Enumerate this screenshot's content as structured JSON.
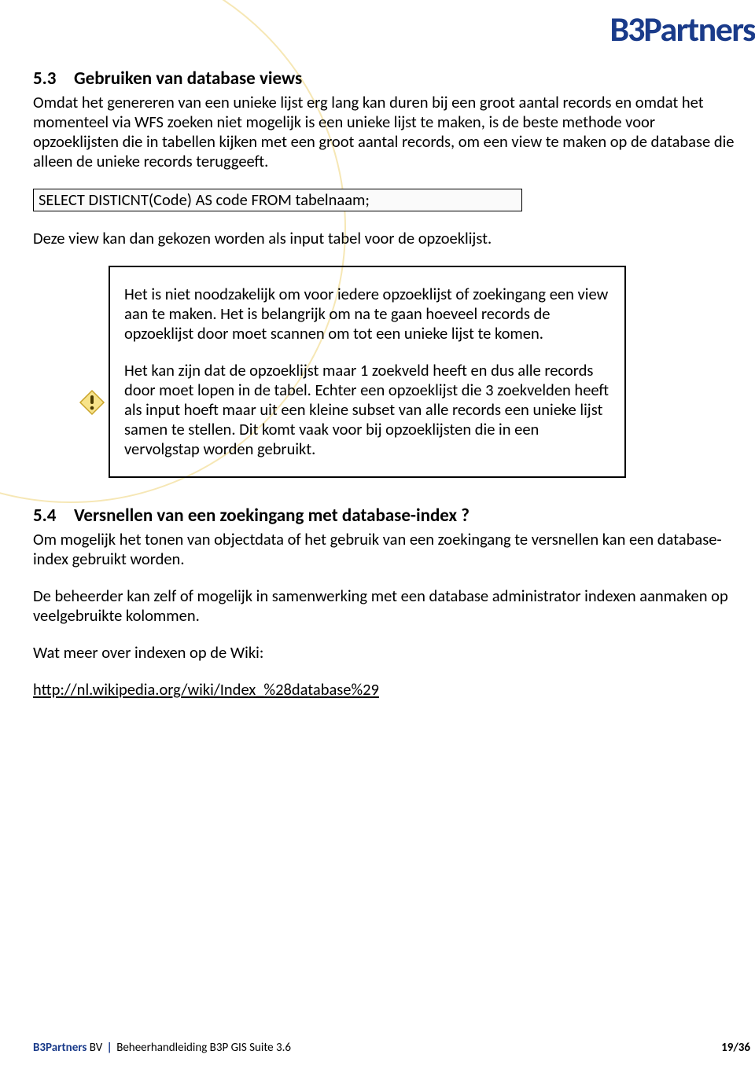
{
  "header": {
    "logo_b3": "B3",
    "logo_partners": "Partners"
  },
  "section53": {
    "num": "5.3",
    "title": "Gebruiken van database views",
    "p1": "Omdat het genereren van een unieke lijst erg lang kan duren bij een groot aantal records en omdat het momenteel via WFS zoeken niet mogelijk is een unieke lijst te maken, is de beste methode voor opzoeklijsten die in tabellen kijken met een groot aantal records, om een view te maken op de database die alleen de unieke records teruggeeft.",
    "code": "SELECT DISTICNT(Code) AS code FROM tabelnaam;",
    "p2": "Deze view kan dan gekozen worden als input tabel voor de opzoeklijst.",
    "note_p1": "Het is niet noodzakelijk om voor iedere opzoeklijst of zoekingang een view aan te maken. Het is belangrijk om na te gaan hoeveel records de opzoeklijst door moet scannen om tot een unieke lijst te komen.",
    "note_p2": "Het kan zijn dat de opzoeklijst maar 1 zoekveld heeft en dus alle records door moet lopen in de tabel. Echter een opzoeklijst die 3 zoekvelden heeft als input hoeft maar uit een kleine subset van alle records een unieke lijst samen te stellen. Dit komt vaak voor bij opzoeklijsten die in een vervolgstap worden gebruikt."
  },
  "section54": {
    "num": "5.4",
    "title": "Versnellen van een zoekingang met database-index ?",
    "p1": "Om mogelijk het tonen van objectdata of het gebruik van een zoekingang te versnellen kan een database-index gebruikt worden.",
    "p2": "De beheerder kan zelf of mogelijk in samenwerking met een database administrator indexen aanmaken op veelgebruikte kolommen.",
    "p3": "Wat meer over indexen op de Wiki:",
    "link_text": "http://nl.wikipedia.org/wiki/Index_%28database%29"
  },
  "footer": {
    "company_b3": "B3Partners",
    "company_suffix": " BV",
    "sep": " | ",
    "doc": "Beheerhandleiding B3P GIS Suite 3.6",
    "page": "19/36"
  }
}
